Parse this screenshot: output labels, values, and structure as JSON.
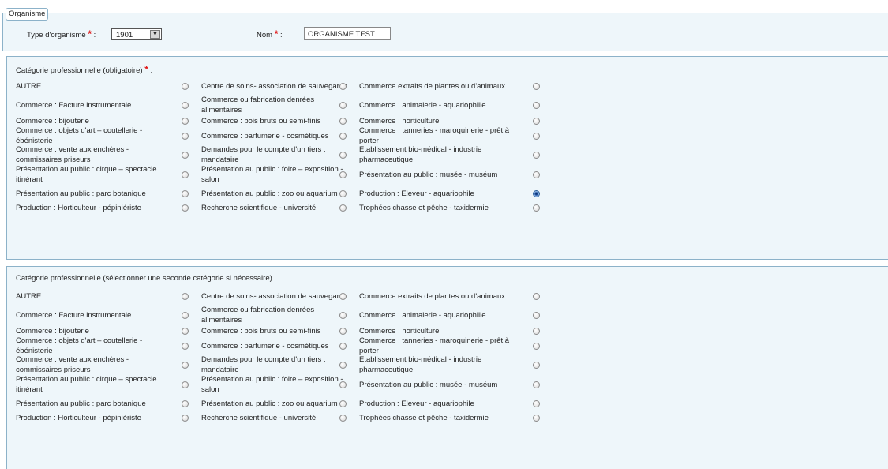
{
  "organisme": {
    "legend": "Organisme",
    "type_label": "Type d'organisme",
    "type_value": "1901",
    "nom_label": "Nom",
    "nom_value": "ORGANISME TEST",
    "required_mark": "*",
    "colon": ":"
  },
  "panels": [
    {
      "title": "Catégorie professionnelle (obligatoire)",
      "required": true,
      "selected": "Production : Eleveur - aquariophile"
    },
    {
      "title": "Catégorie professionnelle (sélectionner une seconde catégorie si nécessaire)",
      "required": false,
      "selected": ""
    }
  ],
  "categories": [
    [
      "AUTRE",
      "Centre de soins- association de sauvegarde",
      "Commerce extraits de plantes ou d'animaux"
    ],
    [
      "Commerce : Facture instrumentale",
      "Commerce ou fabrication denrées alimentaires",
      "Commerce : animalerie - aquariophilie"
    ],
    [
      "Commerce : bijouterie",
      "Commerce : bois bruts ou semi-finis",
      "Commerce : horticulture"
    ],
    [
      "Commerce : objets d'art – coutellerie - ébénisterie",
      "Commerce : parfumerie - cosmétiques",
      "Commerce : tanneries - maroquinerie - prêt à porter"
    ],
    [
      "Commerce : vente aux enchères - commissaires priseurs",
      "Demandes pour le compte d'un tiers : mandataire",
      "Etablissement bio-médical - industrie pharmaceutique"
    ],
    [
      "Présentation au public : cirque – spectacle itinérant",
      "Présentation au public : foire – exposition - salon",
      "Présentation au public : musée - muséum"
    ],
    [
      "Présentation au public : parc botanique",
      "Présentation au public : zoo ou aquarium",
      "Production : Eleveur - aquariophile"
    ],
    [
      "Production : Horticulteur - pépiniériste",
      "Recherche scientifique - université",
      "Trophées chasse et pêche - taxidermie"
    ]
  ]
}
